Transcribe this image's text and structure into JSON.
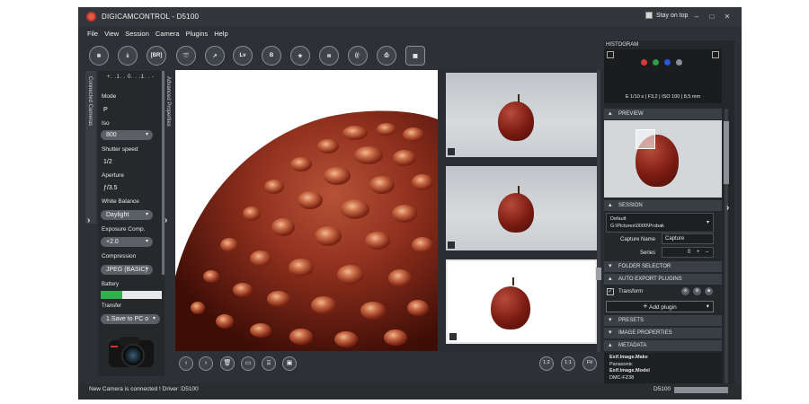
{
  "window": {
    "title": "DIGICAMCONTROL - D5100",
    "stay_on_top": "Stay on top",
    "minimize": "–",
    "maximize": "□",
    "close": "✕"
  },
  "menu": [
    "File",
    "View",
    "Session",
    "Camera",
    "Plugins",
    "Help"
  ],
  "toolbar": {
    "items": [
      {
        "name": "capture-button",
        "text": "✻"
      },
      {
        "name": "download-button",
        "text": "⤓"
      },
      {
        "name": "bracketing-button",
        "text": "[BR]"
      },
      {
        "name": "movie-button",
        "text": "🎬"
      },
      {
        "name": "edit-button",
        "text": "↗"
      },
      {
        "name": "liveview-button",
        "text": "Lv"
      },
      {
        "name": "bulb-button",
        "text": "B"
      },
      {
        "name": "favorite-button",
        "text": "★"
      },
      {
        "name": "layers-button",
        "text": "≋"
      },
      {
        "name": "wireless-button",
        "text": "((·"
      },
      {
        "name": "print-button",
        "text": "⎙"
      },
      {
        "name": "qr-button",
        "text": "▦"
      }
    ]
  },
  "left_panel": {
    "tab_label": "Connected Cameras",
    "exposure_scale": "+. .1. . 0. . .1. . -",
    "mode_label": "Mode",
    "mode_value": "P",
    "iso_label": "Iso",
    "iso_value": "800",
    "shutter_label": "Shutter speed",
    "shutter_value": "1/2",
    "aperture_label": "Aperture",
    "aperture_value": "ƒ/3.5",
    "wb_label": "White Balance",
    "wb_value": "Daylight",
    "exp_comp_label": "Exposure Comp.",
    "exp_comp_value": "+2.0",
    "compression_label": "Compression",
    "compression_value": "JPEG (BASIC)",
    "battery_label": "Battery",
    "battery_level": 0.35,
    "transfer_label": "Transfer",
    "transfer_value": "1.Save to PC o"
  },
  "advanced_tab_label": "Advanced Properties",
  "right_panel": {
    "histogram_label": "HISTOGRAM",
    "exposure_info": "E 1/10 s | F3,2 | ISO 100 | 8,5 mm",
    "preview_label": "PREVIEW",
    "session_label": "SESSION",
    "session_default": "Default",
    "session_path": "G:\\Pictures\\0000\\Probak",
    "capture_name_label": "Capture Name",
    "capture_name_value": "Capture",
    "series_label": "Series",
    "series_value": "0",
    "folder_selector_label": "FOLDER SELECTOR",
    "auto_export_label": "AUTO EXPORT PLUGINS",
    "transform_label": "Transform",
    "add_plugin_label": "Add plugin",
    "presets_label": "PRESETS",
    "image_properties_label": "IMAGE PROPERTIES",
    "metadata_label": "METADATA",
    "metadata": [
      {
        "key": "Exif.Image.Make",
        "value": "Panasonic"
      },
      {
        "key": "Exif.Image.Model",
        "value": "DMC-FZ38"
      }
    ]
  },
  "bottom": {
    "zoom_half": "1:2",
    "zoom_one": "1:1",
    "zoom_fit": "Fit"
  },
  "status": {
    "message": "New Camera is connected ! Driver :D5100",
    "camera": "D5100"
  },
  "colors": {
    "accent_red": "#c0392b",
    "battery_green": "#2fb24a",
    "panel": "#2d3034"
  }
}
